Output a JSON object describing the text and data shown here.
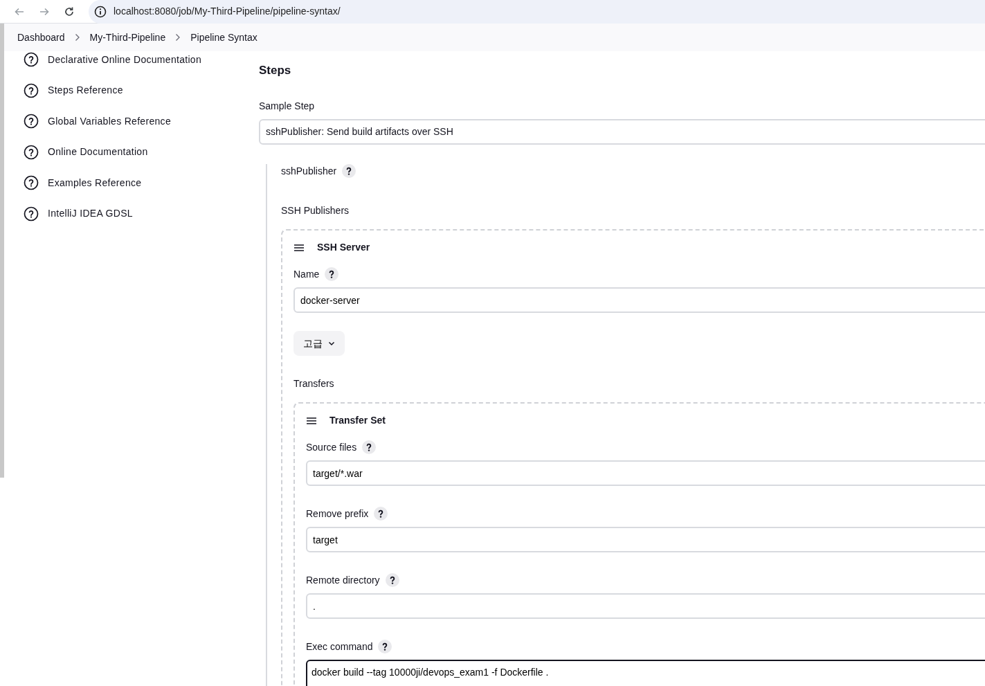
{
  "browser": {
    "url": "localhost:8080/job/My-Third-Pipeline/pipeline-syntax/"
  },
  "breadcrumbs": [
    "Dashboard",
    "My-Third-Pipeline",
    "Pipeline Syntax"
  ],
  "sidebar": {
    "items": [
      {
        "label": "Declarative Online Documentation",
        "kind": "help"
      },
      {
        "label": "Steps Reference",
        "kind": "help"
      },
      {
        "label": "Global Variables Reference",
        "kind": "help"
      },
      {
        "label": "Online Documentation",
        "kind": "help"
      },
      {
        "label": "Examples Reference",
        "kind": "help"
      },
      {
        "label": "IntelliJ IDEA GDSL",
        "kind": "help"
      }
    ]
  },
  "main": {
    "heading": "Steps",
    "sample_step": {
      "label": "Sample Step",
      "value": "sshPublisher: Send build artifacts over SSH"
    },
    "step": {
      "name": "sshPublisher",
      "section": "SSH Publishers",
      "server": {
        "title": "SSH Server",
        "name_label": "Name",
        "name_value": "docker-server",
        "advanced_button": "고급",
        "transfers_label": "Transfers",
        "transfer_set": {
          "title": "Transfer Set",
          "fields": [
            {
              "label": "Source files",
              "value": "target/*.war",
              "kind": "input"
            },
            {
              "label": "Remove prefix",
              "value": "target",
              "kind": "input"
            },
            {
              "label": "Remote directory",
              "value": ".",
              "kind": "input"
            },
            {
              "label": "Exec command",
              "value": "docker build --tag 10000ji/devops_exam1 -f Dockerfile .",
              "kind": "textarea"
            }
          ]
        }
      }
    }
  }
}
